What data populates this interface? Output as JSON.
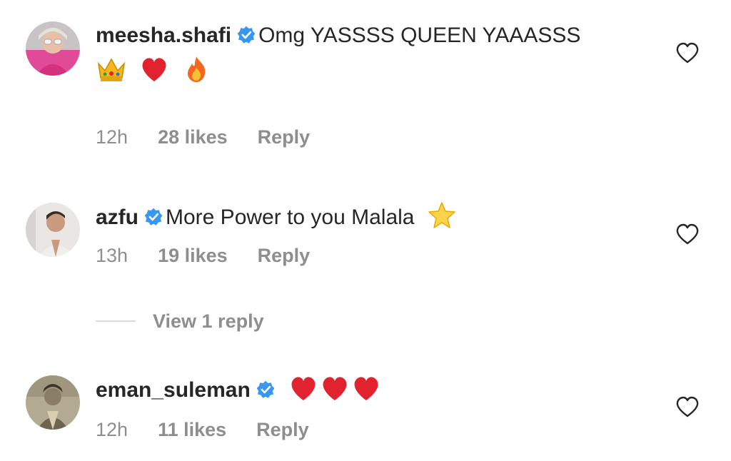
{
  "comments": [
    {
      "username": "meesha.shafi",
      "text": "Omg YASSSS QUEEN YAAASSS",
      "emojis": [
        "crown-emoji",
        "red-heart-emoji",
        "fire-emoji"
      ],
      "time": "12h",
      "likes": "28 likes",
      "reply_label": "Reply"
    },
    {
      "username": "azfu",
      "text": "More Power to you Malala",
      "emojis": [
        "star-emoji"
      ],
      "time": "13h",
      "likes": "19 likes",
      "reply_label": "Reply"
    },
    {
      "username": "eman_suleman",
      "text": "",
      "emojis": [
        "red-heart-emoji",
        "red-heart-emoji",
        "red-heart-emoji"
      ],
      "time": "12h",
      "likes": "11 likes",
      "reply_label": "Reply"
    }
  ],
  "view_replies": {
    "label": "View 1 reply"
  },
  "colors": {
    "text": "#262626",
    "muted": "#8e8e8e",
    "verified": "#3897f0",
    "divider": "#dbdbdb",
    "heart_emoji": "#e0232e"
  }
}
